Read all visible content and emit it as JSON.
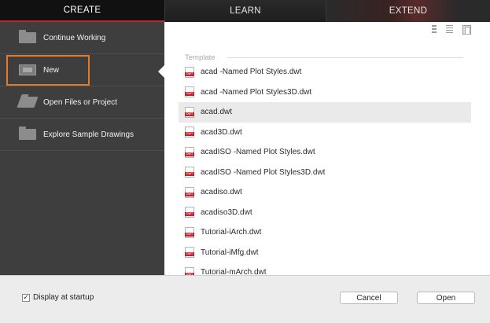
{
  "tabs": [
    "CREATE",
    "LEARN",
    "EXTEND"
  ],
  "sidebar": {
    "items": [
      {
        "label": "Continue Working",
        "icon": "folder-icon"
      },
      {
        "label": "New",
        "icon": "new-drawing-icon"
      },
      {
        "label": "Open Files or Project",
        "icon": "open-folder-icon"
      },
      {
        "label": "Explore Sample Drawings",
        "icon": "folder-icon"
      }
    ],
    "selected": "New"
  },
  "main": {
    "section_title": "Template",
    "view_modes": [
      "list-view-icon",
      "detail-view-icon",
      "grid-view-icon"
    ],
    "files": [
      "acad -Named Plot Styles.dwt",
      "acad -Named Plot Styles3D.dwt",
      "acad.dwt",
      "acad3D.dwt",
      "acadISO -Named Plot Styles.dwt",
      "acadISO -Named Plot Styles3D.dwt",
      "acadiso.dwt",
      "acadiso3D.dwt",
      "Tutorial-iArch.dwt",
      "Tutorial-iMfg.dwt",
      "Tutorial-mArch.dwt"
    ],
    "selected_file": "acad.dwt"
  },
  "footer": {
    "startup_label": "Display at startup",
    "startup_checked": "✓",
    "cancel_label": "Cancel",
    "open_label": "Open"
  },
  "colors": {
    "accent_highlight": "#e07b2b",
    "tab_active_underline": "#c3272b",
    "sidebar_bg": "#3e3e3e"
  }
}
